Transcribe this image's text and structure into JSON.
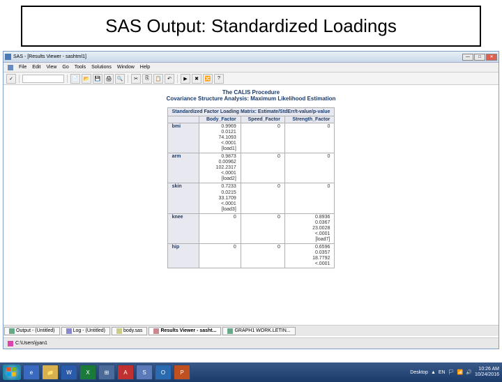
{
  "slide": {
    "title": "SAS Output: Standardized Loadings"
  },
  "window": {
    "title": "SAS - [Results Viewer - sashtml1]",
    "min": "—",
    "max": "□",
    "close": "✕"
  },
  "menu": {
    "file": "File",
    "edit": "Edit",
    "view": "View",
    "go": "Go",
    "tools": "Tools",
    "solutions": "Solutions",
    "window": "Window",
    "help": "Help"
  },
  "output": {
    "proc_title": "The CALIS Procedure",
    "proc_sub": "Covariance Structure Analysis: Maximum Likelihood Estimation",
    "table_caption": "Standardized Factor Loading Matrix: Estimate/StdErr/t-value/p-value",
    "headers": {
      "body": "Body_Factor",
      "speed": "Speed_Factor",
      "strength": "Strength_Factor"
    },
    "rows": {
      "bmi": {
        "label": "bmi",
        "body": "0.9969\n0.0121\n74.1093\n<.0001\n[load1]",
        "speed": "0",
        "strength": "0"
      },
      "arm": {
        "label": "arm",
        "body": "0.9873\n0.00962\n102.2317\n<.0001\n[load2]",
        "speed": "0",
        "strength": "0"
      },
      "skin": {
        "label": "skin",
        "body": "0.7233\n0.0215\n33.1709\n<.0001\n[load3]",
        "speed": "0",
        "strength": "0"
      },
      "knee": {
        "label": "knee",
        "body": "0",
        "speed": "0",
        "strength": "0.8936\n0.0367\n23.0028\n<.0001\n[load7]"
      },
      "hip": {
        "label": "hip",
        "body": "0",
        "speed": "0",
        "strength": "0.6596\n0.0357\n18.7792\n<.0001"
      }
    }
  },
  "tabs": {
    "output": "Output - (Untitled)",
    "log": "Log - (Untitled)",
    "body": "body.sas",
    "results": "Results Viewer - sasht...",
    "graph": "GRAPH1 WORK.LETIN..."
  },
  "status": "C:\\Users\\jyan1",
  "tray": {
    "desktop": "Desktop",
    "lang": "EN",
    "time": "10:26 AM",
    "date": "10/24/2016"
  }
}
